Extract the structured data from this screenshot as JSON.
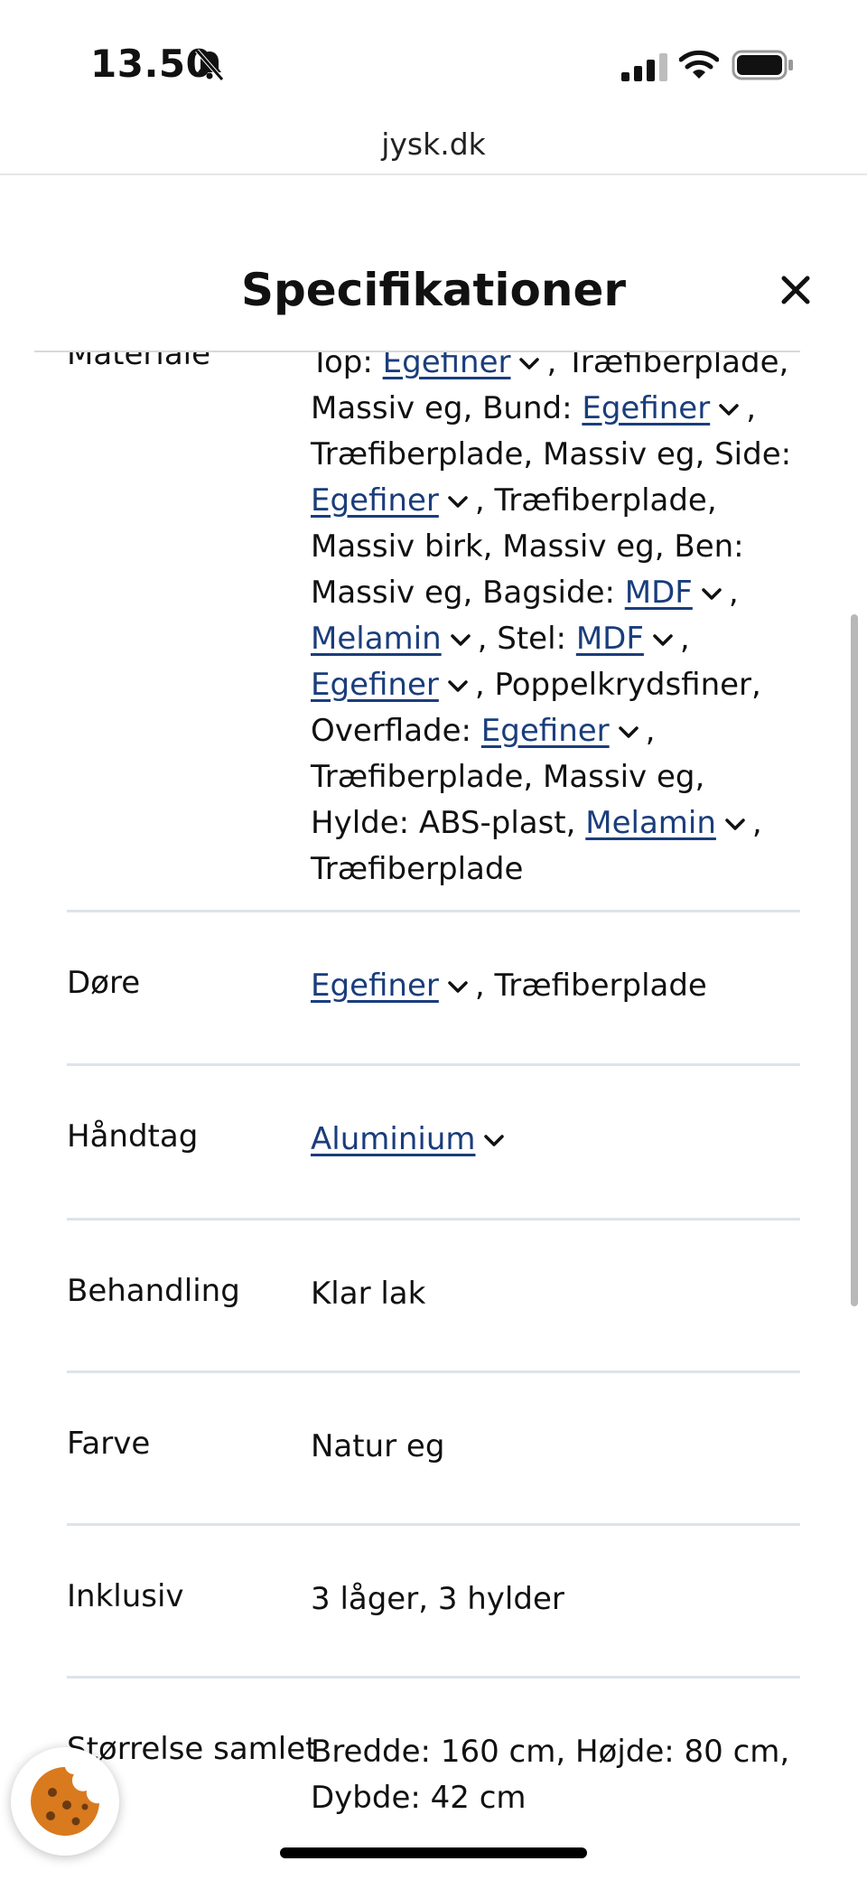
{
  "status_bar": {
    "time": "13.50",
    "icons": [
      "bell-slash-icon",
      "signal-icon",
      "wifi-icon",
      "battery-icon"
    ]
  },
  "browser": {
    "url": "jysk.dk"
  },
  "modal": {
    "title": "Specifikationer",
    "close_icon": "close-icon"
  },
  "colors": {
    "link": "#1a3d7c",
    "divider": "#dde3ea",
    "cookie": "#d97a1e"
  },
  "specs": {
    "materiale": {
      "label": "Materiale",
      "parts": [
        "Top: ",
        "Egefiner",
        ", Træfiberplade, Massiv eg, Bund: ",
        "Egefiner",
        ", Træfiberplade, Massiv eg, Side: ",
        "Egefiner",
        ", Træfiberplade, Massiv birk, Massiv eg, Ben: Massiv eg, Bagside: ",
        "MDF",
        ", ",
        "Melamin",
        ", Stel: ",
        "MDF",
        ", ",
        "Egefiner",
        ", Poppelkrydsfiner, Overflade: ",
        "Egefiner",
        ", Træfiberplade, Massiv eg, Hylde: ABS-plast, ",
        "Melamin",
        ", Træfiberplade"
      ]
    },
    "doere": {
      "label": "Døre",
      "link": "Egefiner",
      "text": ", Træfiberplade"
    },
    "haandtag": {
      "label": "Håndtag",
      "link": "Aluminium"
    },
    "behandling": {
      "label": "Behandling",
      "value": "Klar lak"
    },
    "farve": {
      "label": "Farve",
      "value": "Natur eg"
    },
    "inklusiv": {
      "label": "Inklusiv",
      "value": "3 låger, 3 hylder"
    },
    "stoerrelse": {
      "label": "Størrelse samlet",
      "value": "Bredde: 160 cm, Højde: 80 cm, Dybde: 42 cm"
    }
  },
  "cookie_button": {
    "icon": "cookie-icon"
  }
}
